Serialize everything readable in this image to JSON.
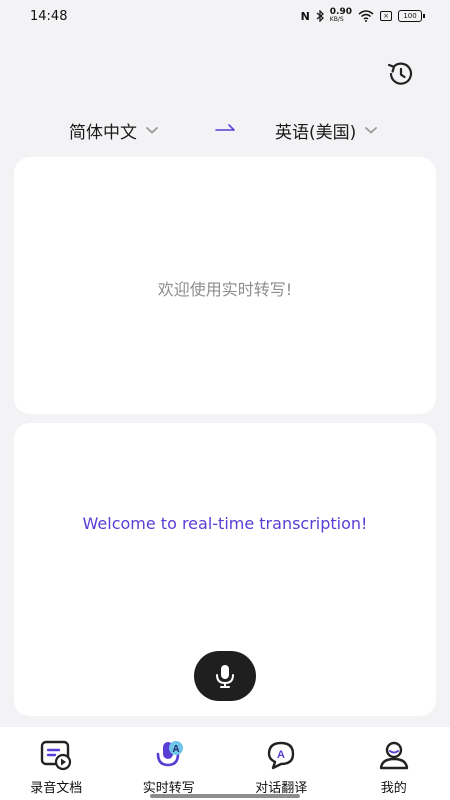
{
  "status": {
    "time": "14:48",
    "nfc_icon": "N",
    "speed_value": "0.90",
    "speed_unit": "KB/S",
    "box_icon": "×",
    "battery": "100"
  },
  "header": {
    "history_icon": "history-icon"
  },
  "languages": {
    "source": "简体中文",
    "target": "英语(美国)",
    "arrow_icon": "arrow-right-icon"
  },
  "source_card": {
    "text": "欢迎使用实时转写!"
  },
  "target_card": {
    "text": "Welcome to real-time transcription!",
    "mic_icon": "microphone-icon"
  },
  "colors": {
    "accent": "#5a3dd6",
    "mic_button": "#1f1f1f",
    "background": "#f3f3f5"
  },
  "tabs": [
    {
      "label": "录音文档",
      "icon": "recording-doc-icon",
      "active": false
    },
    {
      "label": "实时转写",
      "icon": "realtime-transcribe-icon",
      "active": true
    },
    {
      "label": "对话翻译",
      "icon": "dialogue-translate-icon",
      "active": false
    },
    {
      "label": "我的",
      "icon": "profile-icon",
      "active": false
    }
  ]
}
